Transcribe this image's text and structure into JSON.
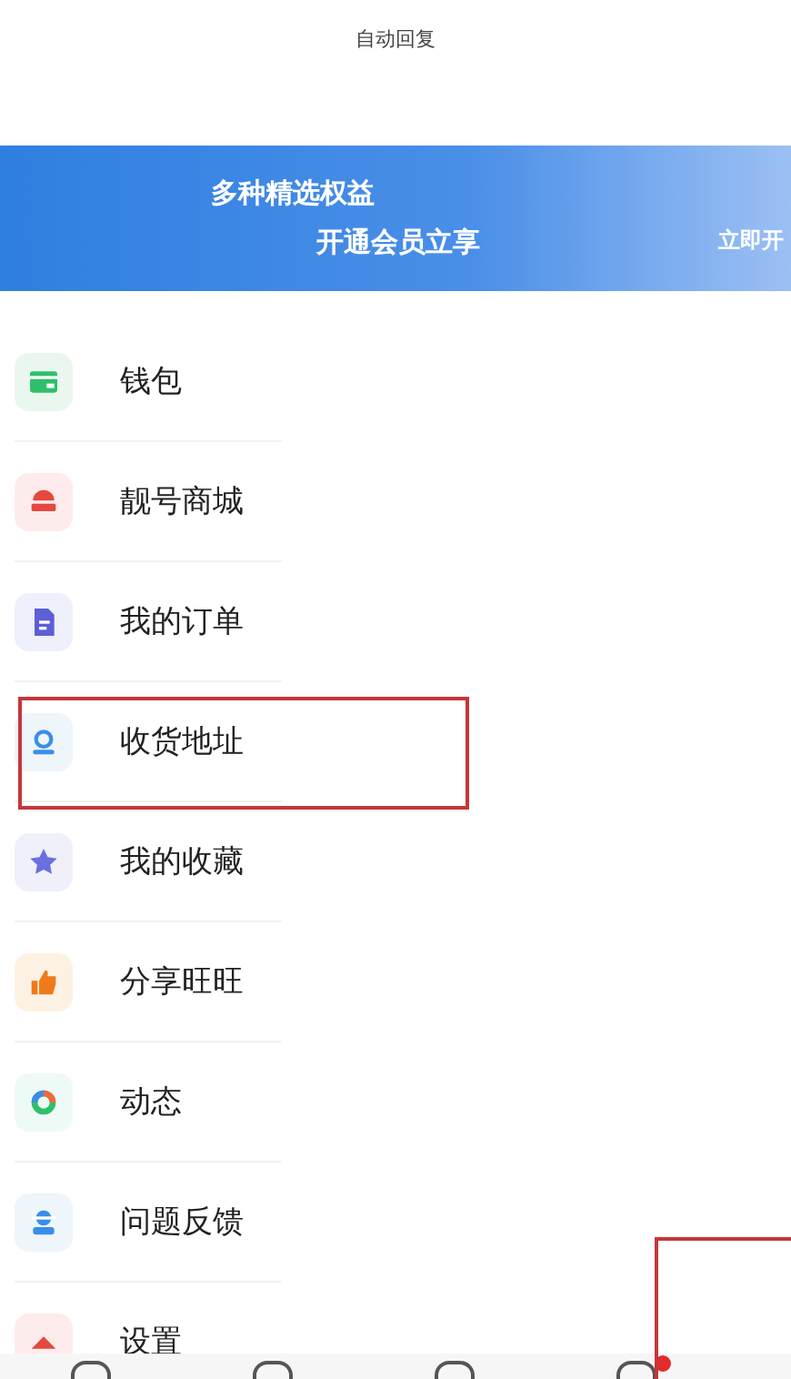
{
  "status_text": "自动回复",
  "banner": {
    "title": "多种精选权益",
    "subtitle": "开通会员立享",
    "action": "立即开"
  },
  "menu": [
    {
      "kind": "wallet",
      "label": "钱包",
      "highlighted": false
    },
    {
      "kind": "shop",
      "label": "靓号商城",
      "highlighted": false
    },
    {
      "kind": "order",
      "label": "我的订单",
      "highlighted": false
    },
    {
      "kind": "address",
      "label": "收货地址",
      "highlighted": true
    },
    {
      "kind": "star",
      "label": "我的收藏",
      "highlighted": false
    },
    {
      "kind": "thumb",
      "label": "分享旺旺",
      "highlighted": false
    },
    {
      "kind": "ring",
      "label": "动态",
      "highlighted": false
    },
    {
      "kind": "support",
      "label": "问题反馈",
      "highlighted": false
    },
    {
      "kind": "settings",
      "label": "设置",
      "highlighted": false
    }
  ],
  "nav": [
    {
      "badge": false
    },
    {
      "badge": false
    },
    {
      "badge": false
    },
    {
      "badge": true
    }
  ]
}
